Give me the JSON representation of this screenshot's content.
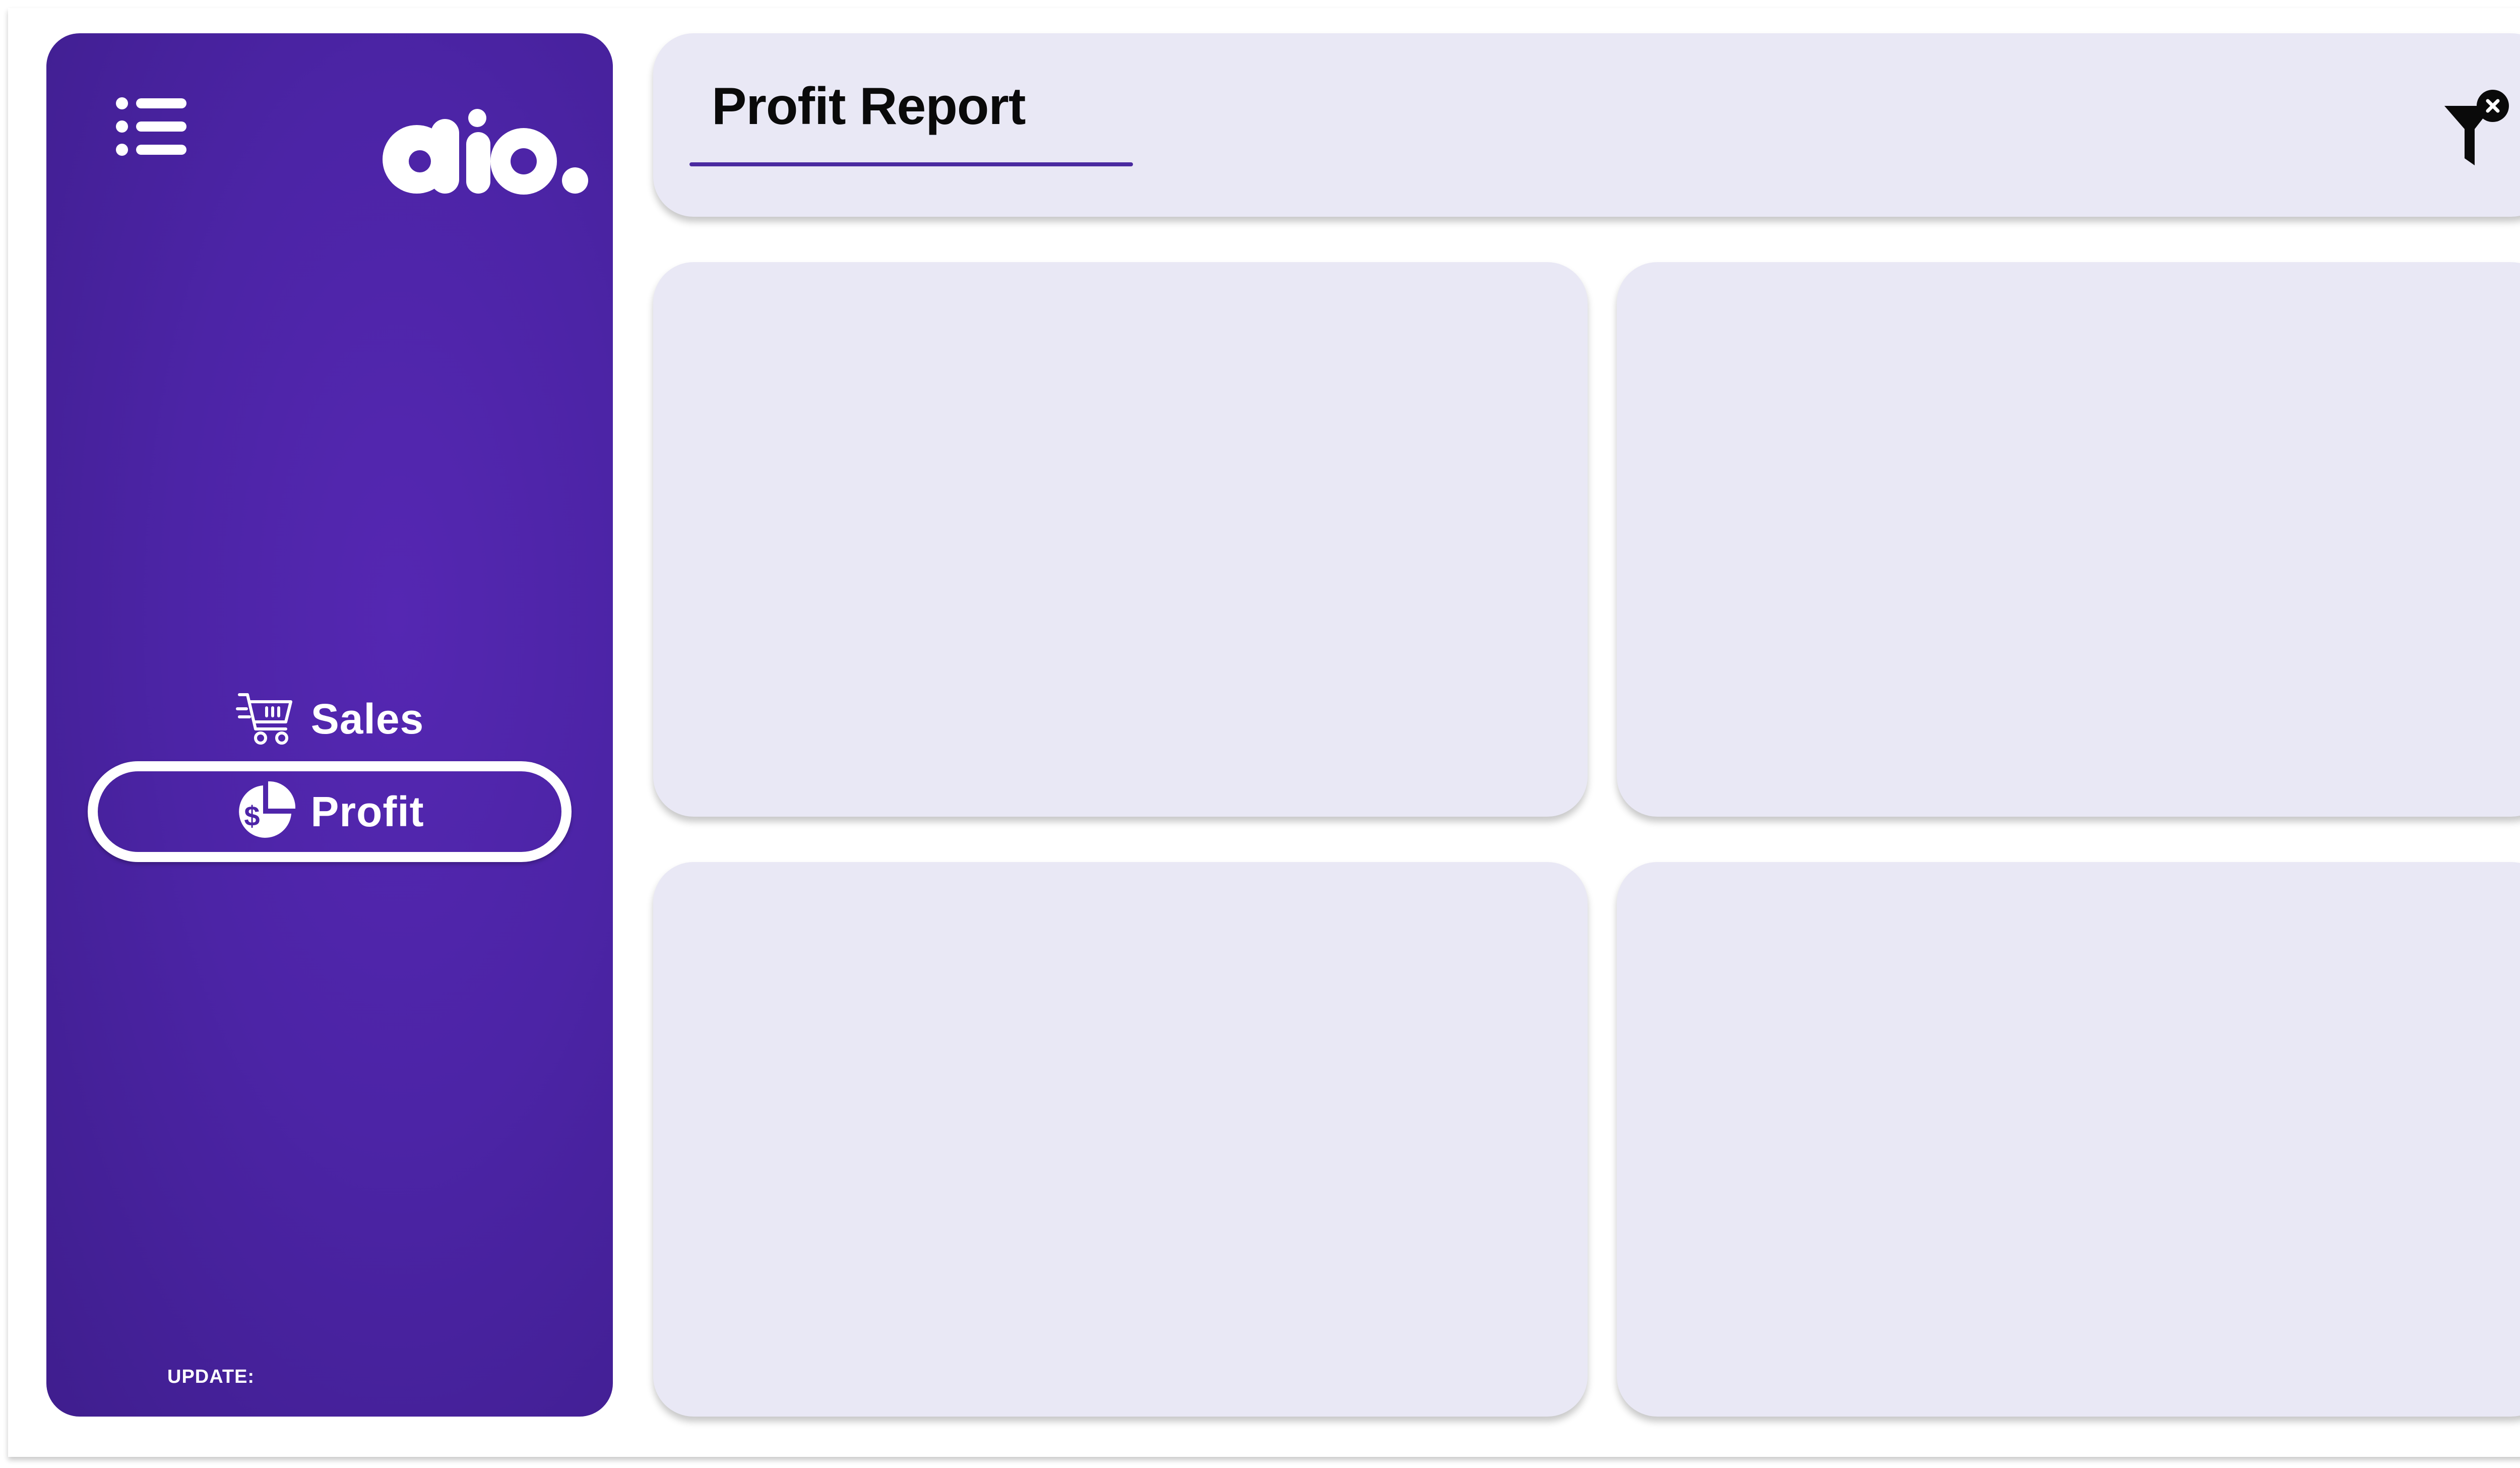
{
  "header": {
    "title": "Profit Report"
  },
  "sidebar": {
    "logo_text": "dio.",
    "nav": [
      {
        "label": "Sales",
        "icon": "shopping-cart-icon",
        "active": false
      },
      {
        "label": "Profit",
        "icon": "pie-chart-dollar-icon",
        "active": true
      }
    ],
    "update_label": "UPDATE:"
  },
  "icons": {
    "menu": "menu-list-icon",
    "filter": "clear-filter-icon"
  },
  "colors": {
    "sidebar_bg": "#4c24a6",
    "panel_bg": "#e9e8f5",
    "accent_underline": "#4a2aa0",
    "text_dark": "#0a0a0a",
    "text_light": "#ffffff"
  }
}
